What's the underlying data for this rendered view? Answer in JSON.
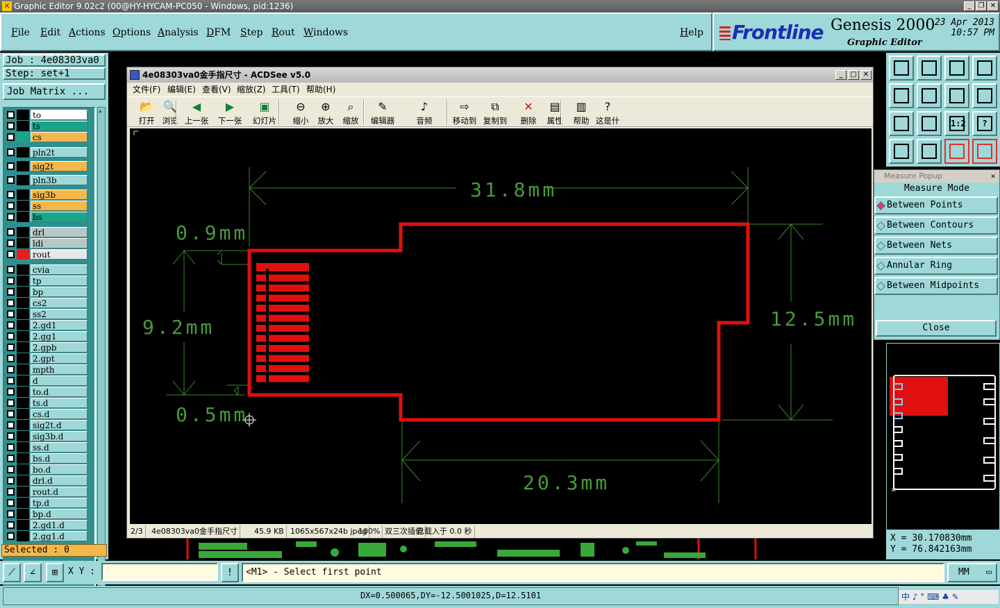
{
  "window": {
    "title": "Graphic Editor 9.02c2 (00@HY-HYCAM-PC050 - Windows, pid:1236)"
  },
  "menu": [
    "File",
    "Edit",
    "Actions",
    "Options",
    "Analysis",
    "DFM",
    "Step",
    "Rout",
    "Windows"
  ],
  "help_label": "Help",
  "brand": {
    "logo": "Frontline",
    "product": "Genesis 2000",
    "subtitle": "Graphic Editor",
    "date": "23 Apr 2013",
    "time": "10:57 PM"
  },
  "job": {
    "job_label": "Job : 4e08303va0",
    "step_label": "Step: set+1",
    "matrix_button": "Job Matrix ..."
  },
  "layers": [
    {
      "name": "to",
      "color": "#ffffff",
      "swatch": "#000000"
    },
    {
      "name": "ts",
      "color": "#1aa58a",
      "swatch": "#000000"
    },
    {
      "name": "cs",
      "color": "#f4b84a",
      "swatch": "#1aa58a"
    },
    {
      "name": "pln2t",
      "color": "#9fd8d8",
      "swatch": "#000000"
    },
    {
      "name": "sig2t",
      "color": "#f4b84a",
      "swatch": "#000000"
    },
    {
      "name": "pln3b",
      "color": "#9fd8d8",
      "swatch": "#000000"
    },
    {
      "name": "sig3b",
      "color": "#f4b84a",
      "swatch": "#000000"
    },
    {
      "name": "ss",
      "color": "#f4b84a",
      "swatch": "#000000"
    },
    {
      "name": "bs",
      "color": "#1aa58a",
      "swatch": "#000000"
    },
    {
      "name": "drl",
      "color": "#b8c8c8",
      "swatch": "#000000"
    },
    {
      "name": "ldi",
      "color": "#b8c8c8",
      "swatch": "#000000"
    },
    {
      "name": "rout",
      "color": "#e8e8e8",
      "swatch": "#e02020"
    },
    {
      "name": "cvia",
      "color": "#9fd8d8",
      "swatch": "#000000"
    },
    {
      "name": "tp",
      "color": "#9fd8d8",
      "swatch": "#000000"
    },
    {
      "name": "bp",
      "color": "#9fd8d8",
      "swatch": "#000000"
    },
    {
      "name": "cs2",
      "color": "#9fd8d8",
      "swatch": "#000000"
    },
    {
      "name": "ss2",
      "color": "#9fd8d8",
      "swatch": "#000000"
    },
    {
      "name": "2.gd1",
      "color": "#9fd8d8",
      "swatch": "#000000"
    },
    {
      "name": "2.gg1",
      "color": "#9fd8d8",
      "swatch": "#000000"
    },
    {
      "name": "2.gpb",
      "color": "#9fd8d8",
      "swatch": "#000000"
    },
    {
      "name": "2.gpt",
      "color": "#9fd8d8",
      "swatch": "#000000"
    },
    {
      "name": "mpth",
      "color": "#9fd8d8",
      "swatch": "#000000"
    },
    {
      "name": "d",
      "color": "#9fd8d8",
      "swatch": "#000000"
    },
    {
      "name": "to.d",
      "color": "#9fd8d8",
      "swatch": "#000000"
    },
    {
      "name": "ts.d",
      "color": "#9fd8d8",
      "swatch": "#000000"
    },
    {
      "name": "cs.d",
      "color": "#9fd8d8",
      "swatch": "#000000"
    },
    {
      "name": "sig2t.d",
      "color": "#9fd8d8",
      "swatch": "#000000"
    },
    {
      "name": "sig3b.d",
      "color": "#9fd8d8",
      "swatch": "#000000"
    },
    {
      "name": "ss.d",
      "color": "#9fd8d8",
      "swatch": "#000000"
    },
    {
      "name": "bs.d",
      "color": "#9fd8d8",
      "swatch": "#000000"
    },
    {
      "name": "bo.d",
      "color": "#9fd8d8",
      "swatch": "#000000"
    },
    {
      "name": "drl.d",
      "color": "#9fd8d8",
      "swatch": "#000000"
    },
    {
      "name": "rout.d",
      "color": "#9fd8d8",
      "swatch": "#000000"
    },
    {
      "name": "tp.d",
      "color": "#9fd8d8",
      "swatch": "#000000"
    },
    {
      "name": "bp.d",
      "color": "#9fd8d8",
      "swatch": "#000000"
    },
    {
      "name": "2.gd1.d",
      "color": "#9fd8d8",
      "swatch": "#000000"
    },
    {
      "name": "2.gg1.d",
      "color": "#9fd8d8",
      "swatch": "#000000"
    }
  ],
  "selected_label": "Selected : 0",
  "tools": [
    "export-icon",
    "import-icon",
    "home-icon",
    "split-view-icon",
    "move-left-icon",
    "move-right-icon",
    "mirror-icon",
    "snap-icon",
    "zoom-fit-icon",
    "center-icon",
    "scale-icon",
    "help-icon",
    "filter-icon",
    "measure-icon",
    "layer-red-icon",
    "layer-red2-icon"
  ],
  "tool_labels": [
    "",
    "",
    "",
    "",
    "",
    "",
    "",
    "",
    "",
    "",
    "1:2",
    "?",
    "",
    "",
    "",
    ""
  ],
  "measure": {
    "title": "Measure Popup",
    "mode_label": "Measure Mode",
    "options": [
      "Between Points",
      "Between Contours",
      "Between Nets",
      "Annular Ring",
      "Between Midpoints"
    ],
    "selected_index": 0,
    "close_label": "Close"
  },
  "coords": {
    "x": "X = 30.170830mm",
    "y": "Y = 76.842163mm"
  },
  "cmd": {
    "xy_label": "X Y :",
    "xy_value": "",
    "prompt": "<M1> - Select first point",
    "units": "MM"
  },
  "status": {
    "dx": "DX=0.500065,DY=-12.5001025,D=12.5101",
    "ime": "中 ♪ ° ⌨ ♣ ✎"
  },
  "acdsee": {
    "title": "4e08303va0金手指尺寸 - ACDSee v5.0",
    "menu": [
      "文件(F)",
      "编辑(E)",
      "查看(V)",
      "缩放(Z)",
      "工具(T)",
      "帮助(H)"
    ],
    "tools": [
      {
        "label": "打开",
        "icon": "open-folder-icon"
      },
      {
        "label": "浏览",
        "icon": "browse-icon"
      },
      {
        "label": "上一张",
        "icon": "prev-image-icon"
      },
      {
        "label": "下一张",
        "icon": "next-image-icon"
      },
      {
        "label": "幻灯片",
        "icon": "slideshow-icon"
      },
      {
        "label": "缩小",
        "icon": "zoom-out-icon"
      },
      {
        "label": "放大",
        "icon": "zoom-in-icon"
      },
      {
        "label": "缩放",
        "icon": "zoom-icon"
      },
      {
        "label": "编辑器",
        "icon": "editor-icon"
      },
      {
        "label": "音频",
        "icon": "audio-icon"
      },
      {
        "label": "移动到",
        "icon": "move-to-icon"
      },
      {
        "label": "复制到",
        "icon": "copy-to-icon"
      },
      {
        "label": "删除",
        "icon": "delete-icon"
      },
      {
        "label": "属性",
        "icon": "properties-icon"
      },
      {
        "label": "帮助",
        "icon": "help-book-icon"
      },
      {
        "label": "这是什么?",
        "icon": "whats-this-icon"
      }
    ],
    "status": [
      "2/3",
      "4e08303va0金手指尺寸",
      "45.9 KB",
      "1065x567x24b jpeg",
      "100%",
      "双三次插值",
      "已载入于 0.0 秒"
    ],
    "dims": {
      "top": "31.8mm",
      "left_top": "0.9mm",
      "left_mid": "9.2mm",
      "left_bottom": "0.5mm",
      "right": "12.5mm",
      "bottom": "20.3mm"
    }
  },
  "colors": {
    "panel": "#9fd8d8",
    "outline": "#e01010",
    "dim": "#4a9a3a",
    "background": "#000000"
  }
}
